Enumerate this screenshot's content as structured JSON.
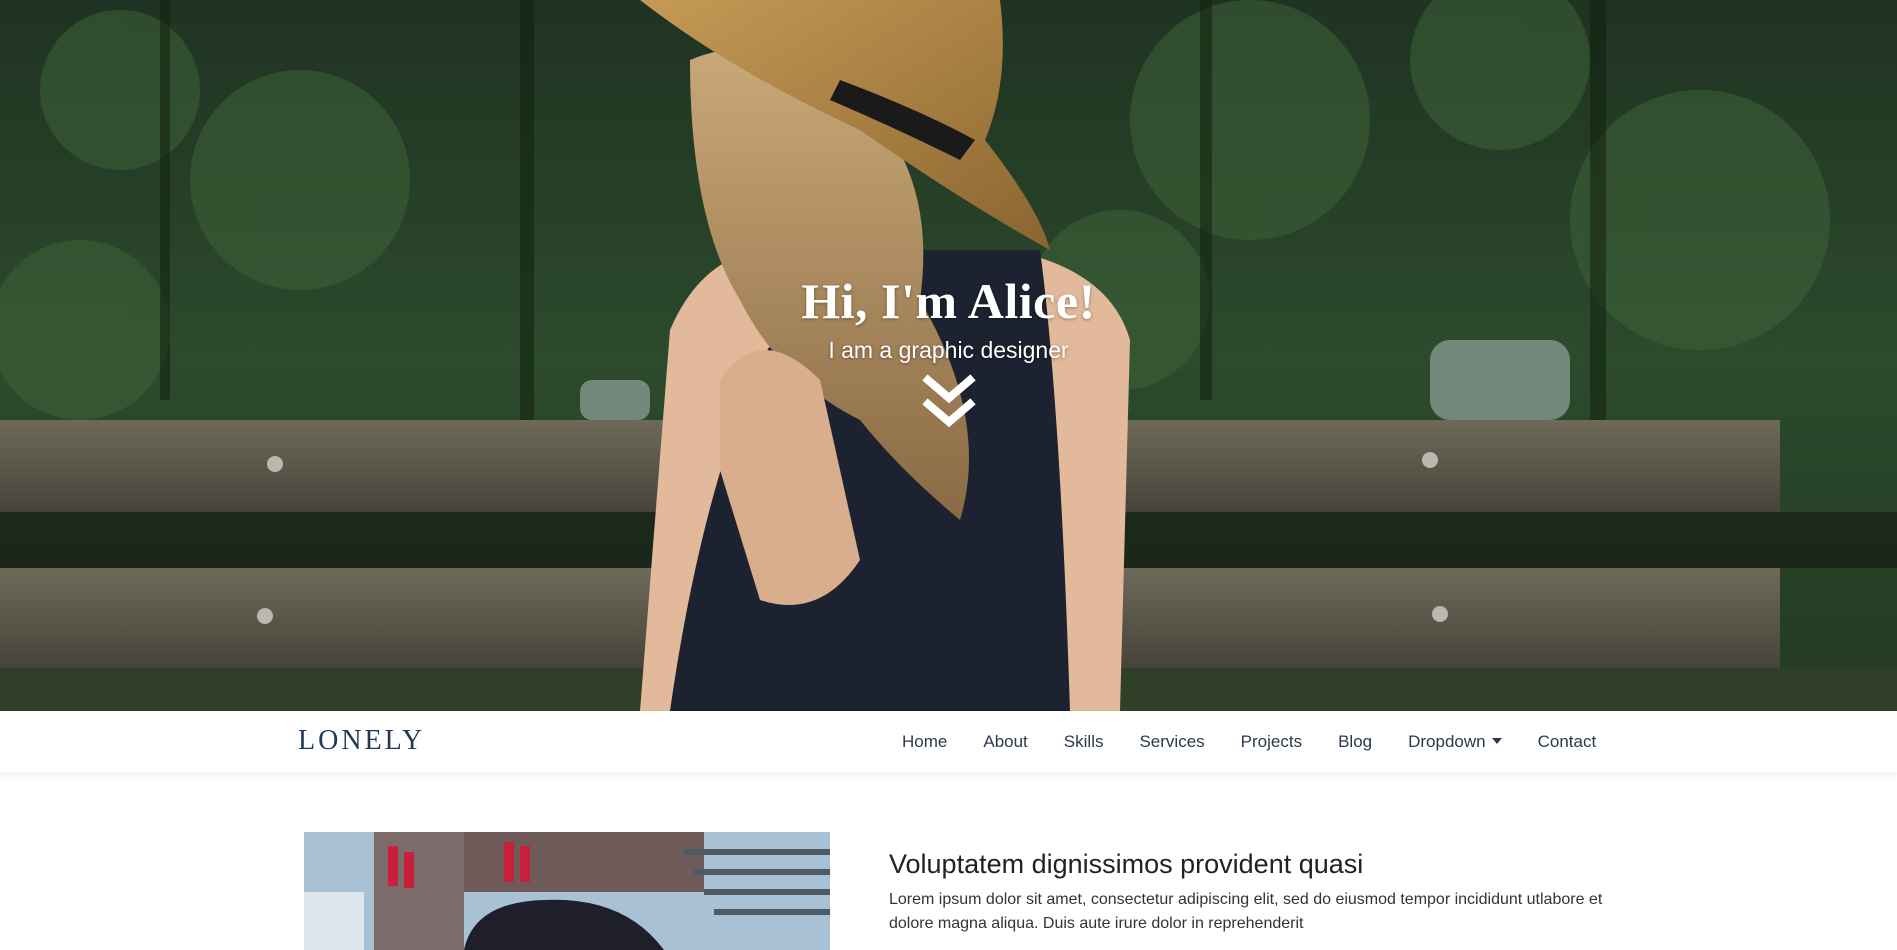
{
  "hero": {
    "title": "Hi, I'm Alice!",
    "subtitle": "I am a graphic designer",
    "scroll_icon": "double-chevron-down-icon"
  },
  "navbar": {
    "brand": "LONELY",
    "items": [
      {
        "label": "Home"
      },
      {
        "label": "About"
      },
      {
        "label": "Skills"
      },
      {
        "label": "Services"
      },
      {
        "label": "Projects"
      },
      {
        "label": "Blog"
      },
      {
        "label": "Dropdown",
        "has_caret": true
      },
      {
        "label": "Contact"
      }
    ]
  },
  "about": {
    "heading": "Voluptatem dignissimos provident quasi",
    "body": "Lorem ipsum dolor sit amet, consectetur adipiscing elit, sed do eiusmod tempor incididunt utlabore et dolore magna aliqua. Duis aute irure dolor in reprehenderit"
  },
  "colors": {
    "brand": "#1f3a57",
    "nav_text": "#2b3a4e",
    "heading_text": "#222222",
    "hero_text": "#ffffff"
  }
}
